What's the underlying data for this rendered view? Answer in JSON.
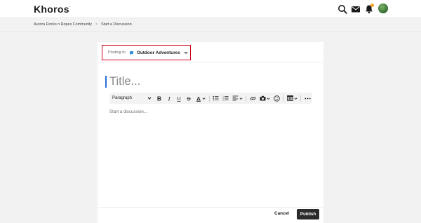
{
  "header": {
    "logo_text": "Khoros",
    "logo_mark": "-",
    "icons": [
      "search-icon",
      "mail-icon",
      "bell-icon",
      "avatar"
    ],
    "notification_dot_color": "#f5a623"
  },
  "breadcrumb": {
    "items": [
      "Aurora Rocks n Ropes Community",
      "Start a Discussion"
    ],
    "separator": ">"
  },
  "editor": {
    "posting_to_label": "Posting to",
    "board_name": "Outdoor Adventures",
    "title_placeholder": "Title...",
    "format_select_value": "Paragraph",
    "toolbar_buttons": [
      "bold",
      "italic",
      "underline",
      "strikethrough",
      "text-color",
      "bulleted-list",
      "numbered-list",
      "align",
      "link",
      "insert-image",
      "emoji",
      "insert-table",
      "more"
    ],
    "body_placeholder": "Start a discussion...",
    "cancel_label": "Cancel",
    "publish_label": "Publish",
    "highlight_color": "#d0021b",
    "board_icon_color": "#3b8ee0",
    "caret_color": "#2b6fd6"
  }
}
